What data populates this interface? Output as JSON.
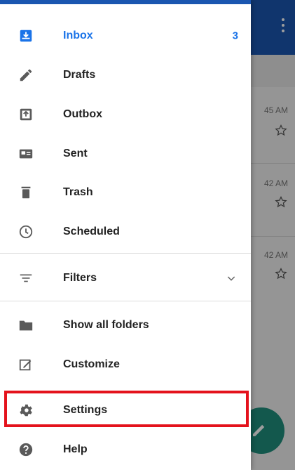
{
  "background": {
    "times": [
      "45 AM",
      "42 AM",
      "42 AM"
    ]
  },
  "drawer": {
    "items": [
      {
        "label": "Inbox",
        "count": "3",
        "icon": "inbox-icon"
      },
      {
        "label": "Drafts",
        "icon": "pencil-icon"
      },
      {
        "label": "Outbox",
        "icon": "outbox-icon"
      },
      {
        "label": "Sent",
        "icon": "sent-icon"
      },
      {
        "label": "Trash",
        "icon": "trash-icon"
      },
      {
        "label": "Scheduled",
        "icon": "clock-icon"
      },
      {
        "label": "Filters",
        "icon": "filter-icon"
      },
      {
        "label": "Show all folders",
        "icon": "folder-icon"
      },
      {
        "label": "Customize",
        "icon": "edit-box-icon"
      },
      {
        "label": "Settings",
        "icon": "gear-icon"
      },
      {
        "label": "Help",
        "icon": "help-icon"
      }
    ]
  },
  "colors": {
    "accent": "#1a73e8",
    "appbar": "#1a56b0",
    "highlight": "#e4121c",
    "fab": "#1f8f7d"
  }
}
